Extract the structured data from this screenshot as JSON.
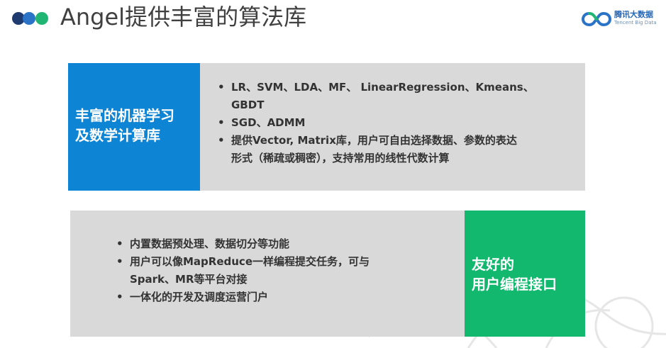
{
  "header": {
    "title": "Angel提供丰富的算法库"
  },
  "logo": {
    "name_cn": "腾讯大数据",
    "name_en": "Tencent Big Data"
  },
  "colors": {
    "dot_dark": "#1f3a6e",
    "dot_blue": "#2a73c6",
    "dot_green": "#21b573",
    "blue_panel": "#0e84d4",
    "green_panel": "#12b86e",
    "gray_panel": "#d9d9d9"
  },
  "panel1": {
    "label_line1": "丰富的机器学习",
    "label_line2": "及数学计算库",
    "bullets": [
      {
        "dot": "•",
        "line1": "LR、SVM、LDA、MF、 LinearRegression、Kmeans、",
        "line2": "GBDT"
      },
      {
        "dot": "•",
        "line1": "SGD、ADMM",
        "line2": ""
      },
      {
        "dot": "•",
        "line1": "提供Vector, Matrix库，用户可自由选择数据、参数的表达",
        "line2": "形式（稀疏或稠密），支持常用的线性代数计算"
      }
    ]
  },
  "panel2": {
    "label_line1": "友好的",
    "label_line2": "用户编程接口",
    "bullets": [
      {
        "dot": "•",
        "line1": "内置数据预处理、数据切分等功能",
        "line2": ""
      },
      {
        "dot": "•",
        "line1": "用户可以像MapReduce一样编程提交任务，可与",
        "line2": "Spark、MR等平台对接"
      },
      {
        "dot": "•",
        "line1": "一体化的开发及调度运营门户",
        "line2": ""
      }
    ]
  }
}
